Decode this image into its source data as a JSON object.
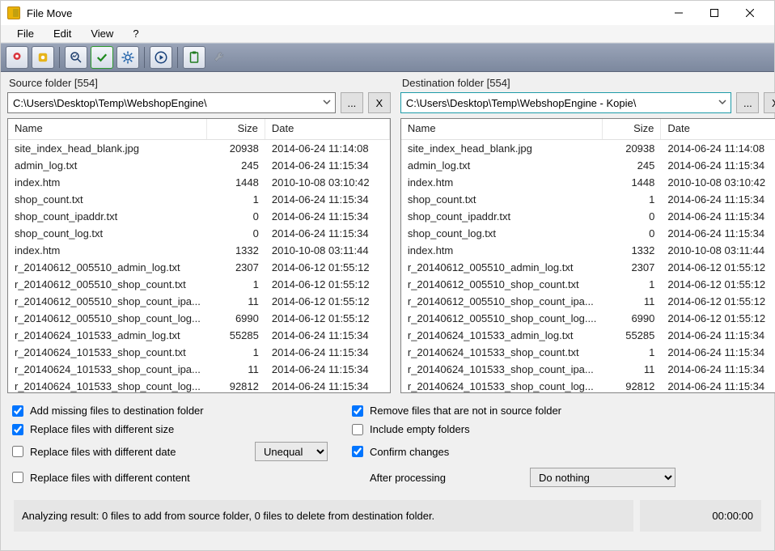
{
  "title": "File Move",
  "menu": {
    "file": "File",
    "edit": "Edit",
    "view": "View",
    "help": "?"
  },
  "source": {
    "label": "Source folder [554]",
    "path": "C:\\Users\\Desktop\\Temp\\WebshopEngine\\",
    "browse": "...",
    "clear": "X",
    "headers": {
      "name": "Name",
      "size": "Size",
      "date": "Date"
    }
  },
  "dest": {
    "label": "Destination folder [554]",
    "path": "C:\\Users\\Desktop\\Temp\\WebshopEngine - Kopie\\",
    "browse": "...",
    "clear": "X",
    "headers": {
      "name": "Name",
      "size": "Size",
      "date": "Date"
    }
  },
  "files": [
    {
      "name": "site_index_head_blank.jpg",
      "size": "20938",
      "date": "2014-06-24 11:14:08"
    },
    {
      "name": "admin_log.txt",
      "size": "245",
      "date": "2014-06-24 11:15:34"
    },
    {
      "name": "index.htm",
      "size": "1448",
      "date": "2010-10-08 03:10:42"
    },
    {
      "name": "shop_count.txt",
      "size": "1",
      "date": "2014-06-24 11:15:34"
    },
    {
      "name": "shop_count_ipaddr.txt",
      "size": "0",
      "date": "2014-06-24 11:15:34"
    },
    {
      "name": "shop_count_log.txt",
      "size": "0",
      "date": "2014-06-24 11:15:34"
    },
    {
      "name": "index.htm",
      "size": "1332",
      "date": "2010-10-08 03:11:44"
    },
    {
      "name": "r_20140612_005510_admin_log.txt",
      "size": "2307",
      "date": "2014-06-12 01:55:12"
    },
    {
      "name": "r_20140612_005510_shop_count.txt",
      "size": "1",
      "date": "2014-06-12 01:55:12"
    },
    {
      "name": "r_20140612_005510_shop_count_ipa...",
      "size": "11",
      "date": "2014-06-12 01:55:12"
    },
    {
      "name": "r_20140612_005510_shop_count_log...",
      "size": "6990",
      "date": "2014-06-12 01:55:12"
    },
    {
      "name": "r_20140624_101533_admin_log.txt",
      "size": "55285",
      "date": "2014-06-24 11:15:34"
    },
    {
      "name": "r_20140624_101533_shop_count.txt",
      "size": "1",
      "date": "2014-06-24 11:15:34"
    },
    {
      "name": "r_20140624_101533_shop_count_ipa...",
      "size": "11",
      "date": "2014-06-24 11:15:34"
    },
    {
      "name": "r_20140624_101533_shop_count_log...",
      "size": "92812",
      "date": "2014-06-24 11:15:34"
    }
  ],
  "destfiles": [
    {
      "name": "site_index_head_blank.jpg",
      "size": "20938",
      "date": "2014-06-24 11:14:08"
    },
    {
      "name": "admin_log.txt",
      "size": "245",
      "date": "2014-06-24 11:15:34"
    },
    {
      "name": "index.htm",
      "size": "1448",
      "date": "2010-10-08 03:10:42"
    },
    {
      "name": "shop_count.txt",
      "size": "1",
      "date": "2014-06-24 11:15:34"
    },
    {
      "name": "shop_count_ipaddr.txt",
      "size": "0",
      "date": "2014-06-24 11:15:34"
    },
    {
      "name": "shop_count_log.txt",
      "size": "0",
      "date": "2014-06-24 11:15:34"
    },
    {
      "name": "index.htm",
      "size": "1332",
      "date": "2010-10-08 03:11:44"
    },
    {
      "name": "r_20140612_005510_admin_log.txt",
      "size": "2307",
      "date": "2014-06-12 01:55:12"
    },
    {
      "name": "r_20140612_005510_shop_count.txt",
      "size": "1",
      "date": "2014-06-12 01:55:12"
    },
    {
      "name": "r_20140612_005510_shop_count_ipa...",
      "size": "11",
      "date": "2014-06-12 01:55:12"
    },
    {
      "name": "r_20140612_005510_shop_count_log....",
      "size": "6990",
      "date": "2014-06-12 01:55:12"
    },
    {
      "name": "r_20140624_101533_admin_log.txt",
      "size": "55285",
      "date": "2014-06-24 11:15:34"
    },
    {
      "name": "r_20140624_101533_shop_count.txt",
      "size": "1",
      "date": "2014-06-24 11:15:34"
    },
    {
      "name": "r_20140624_101533_shop_count_ipa...",
      "size": "11",
      "date": "2014-06-24 11:15:34"
    },
    {
      "name": "r_20140624_101533_shop_count_log...",
      "size": "92812",
      "date": "2014-06-24 11:15:34"
    }
  ],
  "opts": {
    "add_missing": "Add missing files to destination folder",
    "replace_size": "Replace files with different size",
    "replace_date": "Replace files with different date",
    "replace_content": "Replace files with different content",
    "remove_extra": "Remove files that are not in source folder",
    "include_empty": "Include empty folders",
    "confirm": "Confirm changes",
    "after_label": "After processing",
    "date_combo": "Unequal",
    "after_combo": "Do nothing"
  },
  "status": {
    "text": "Analyzing result: 0 files to add from source folder, 0 files to delete from destination folder.",
    "time": "00:00:00"
  }
}
